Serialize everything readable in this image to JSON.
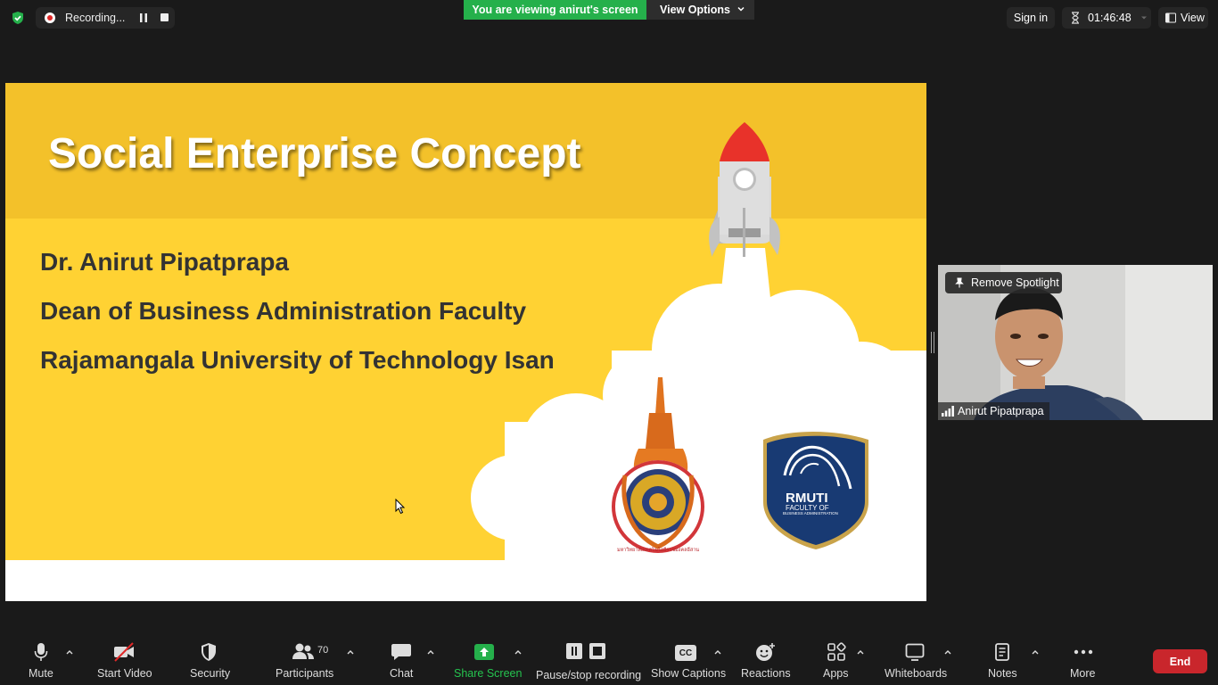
{
  "topbar": {
    "recording_label": "Recording...",
    "viewing_banner": "You are viewing anirut's screen",
    "view_options_label": "View Options",
    "sign_in_label": "Sign in",
    "elapsed_time": "01:46:48",
    "view_label": "View"
  },
  "slide": {
    "title": "Social Enterprise Concept",
    "lines": [
      "Dr. Anirut Pipatprapa",
      "Dean of Business Administration Faculty",
      "Rajamangala University of Technology Isan"
    ],
    "rmuti_logo_text": "RMUTI",
    "rmuti_logo_sub1": "FACULTY OF",
    "rmuti_logo_sub2": "BUSINESS ADMINISTRATION",
    "seal_text": "มหาวิทยาลัยเทคโนโลยีราชมงคลอีสาน"
  },
  "video": {
    "remove_spotlight_label": "Remove Spotlight",
    "participant_name": "Anirut Pipatprapa"
  },
  "toolbar": {
    "mute": "Mute",
    "start_video": "Start Video",
    "security": "Security",
    "participants": "Participants",
    "participant_count": "70",
    "chat": "Chat",
    "share_screen": "Share Screen",
    "pause_stop_recording": "Pause/stop recording",
    "show_captions": "Show Captions",
    "cc_text": "CC",
    "reactions": "Reactions",
    "apps": "Apps",
    "whiteboards": "Whiteboards",
    "notes": "Notes",
    "more": "More",
    "end": "End"
  },
  "colors": {
    "background": "#1a1a1a",
    "viewing_banner": "#25b04b",
    "share_green": "#25b04b",
    "end_red": "#c9262c",
    "slide_yellow": "#ffd233",
    "slide_band": "#f3c12a",
    "recording_red": "#e02828"
  }
}
